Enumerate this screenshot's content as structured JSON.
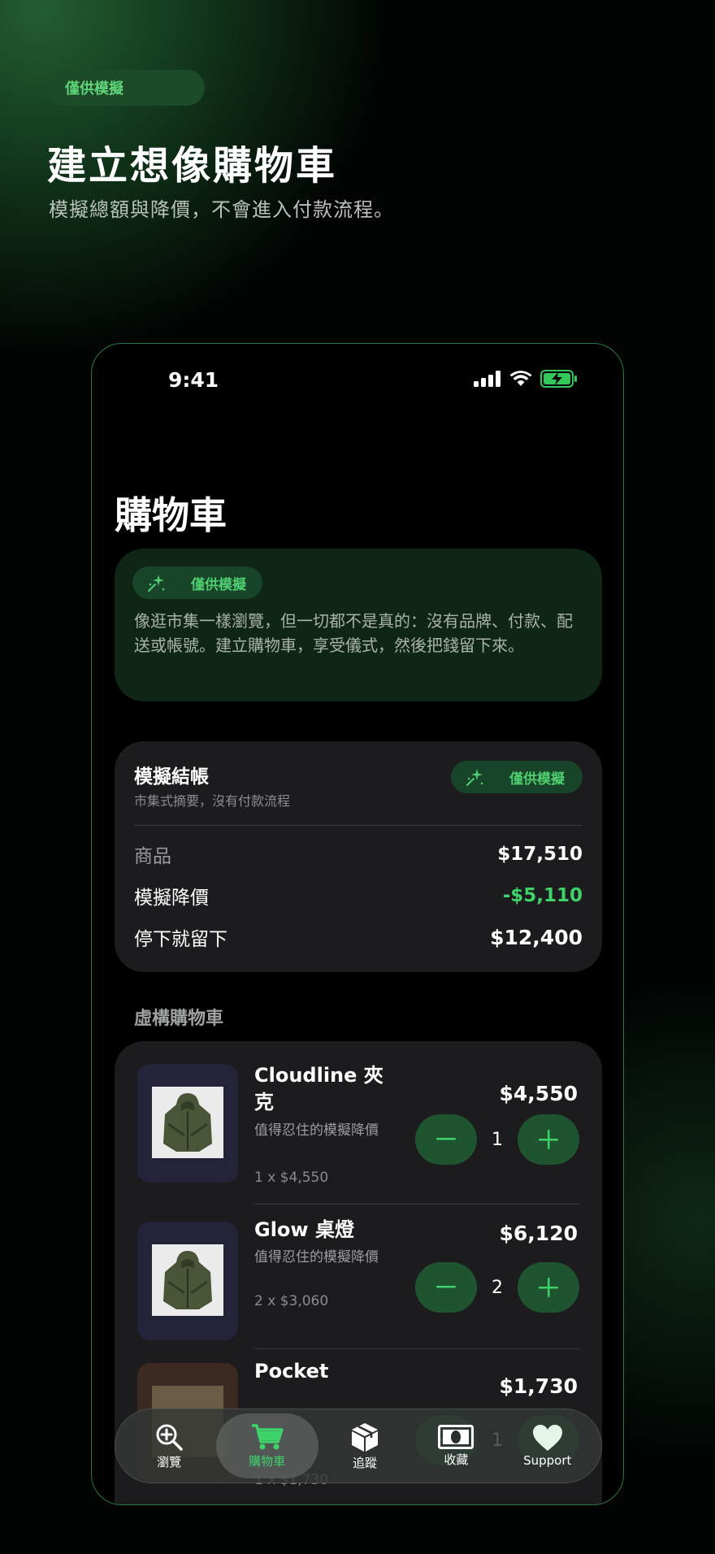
{
  "hero": {
    "badge": "僅供模擬",
    "title": "建立想像購物車",
    "subtitle": "模擬總額與降價，不會進入付款流程。"
  },
  "status_bar": {
    "time": "9:41"
  },
  "page_title": "購物車",
  "info_card": {
    "badge": "僅供模擬",
    "text": "像逛市集一樣瀏覽，但一切都不是真的：沒有品牌、付款、配送或帳號。建立購物車，享受儀式，然後把錢留下來。"
  },
  "summary": {
    "title": "模擬結帳",
    "subtitle": "市集式摘要，沒有付款流程",
    "badge": "僅供模擬",
    "rows": [
      {
        "label": "商品",
        "value": "$17,510"
      },
      {
        "label": "模擬降價",
        "value": "-$5,110"
      },
      {
        "label": "停下就留下",
        "value": "$12,400"
      }
    ]
  },
  "cart_section_title": "虛構購物車",
  "cart_items": [
    {
      "name": "Cloudline 夾克",
      "note": "值得忍住的模擬降價",
      "unit": "1 x $4,550",
      "price": "$4,550",
      "qty": "1"
    },
    {
      "name": "Glow 桌燈",
      "note": "值得忍住的模擬降價",
      "unit": "2 x $3,060",
      "price": "$6,120",
      "qty": "2"
    },
    {
      "name": "Pocket",
      "note": "",
      "unit": "1 x $1,730",
      "price": "$1,730",
      "qty": "1"
    }
  ],
  "tab_bar": [
    {
      "label": "瀏覽",
      "icon": "zoom-in-icon"
    },
    {
      "label": "購物車",
      "icon": "cart-icon",
      "active": true
    },
    {
      "label": "追蹤",
      "icon": "package-icon"
    },
    {
      "label": "收藏",
      "icon": "banknote-icon"
    },
    {
      "label": "Support",
      "icon": "heart-icon"
    }
  ],
  "colors": {
    "accent": "#3fd16a",
    "discount": "#3fd16a",
    "card": "#1c1c1e",
    "border": "#2e7a43"
  }
}
